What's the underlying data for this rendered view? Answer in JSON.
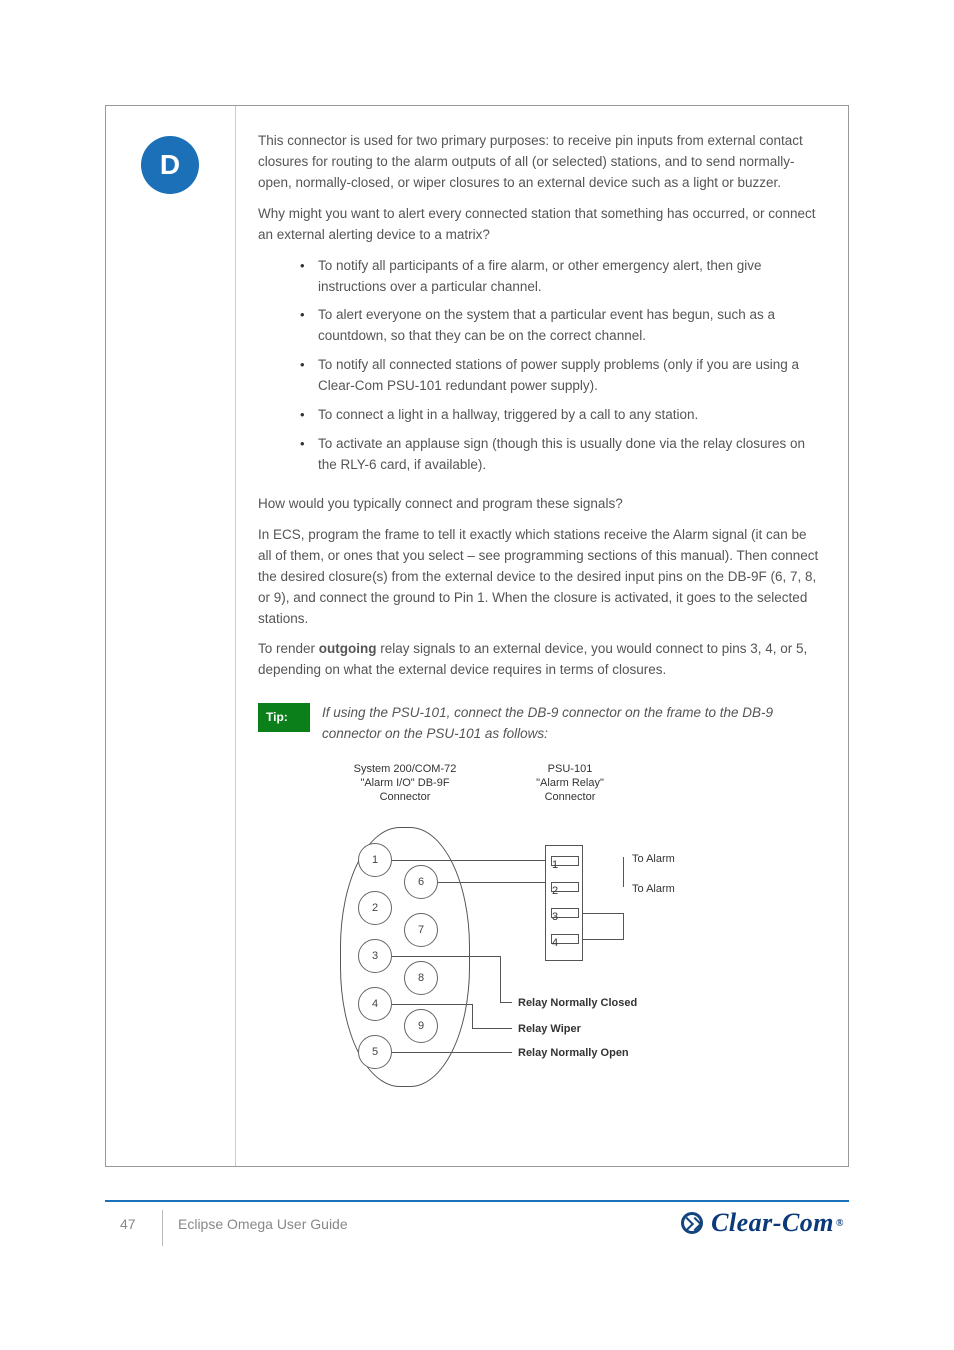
{
  "badge": "D",
  "lead": "This connector is used for two primary purposes: to receive pin inputs from external contact closures for routing to the alarm outputs of all (or selected) stations, and to send normally-open, normally-closed, or wiper closures to an external device such as a light or buzzer.",
  "why_intro": "Why might you want to alert every connected station that something has occurred, or connect an external alerting device to a matrix?",
  "bullets": [
    "To notify all participants of a fire alarm, or other emergency alert, then give instructions over a particular channel.",
    "To alert everyone on the system that a particular event has begun, such as a countdown, so that they can be on the correct channel.",
    "To notify all connected stations of power supply problems (only if you are using a Clear-Com PSU-101 redundant power supply).",
    "To connect a light in a hallway, triggered by a call to any station.",
    "To activate an applause sign (though this is usually done via the relay closures on the RLY-6 card, if available)."
  ],
  "how": "How would you typically connect and program these signals?",
  "how_body": "In ECS, program the frame to tell it exactly which stations receive the Alarm signal (it can be all of them, or ones that you select – see programming sections of this manual). Then connect the desired closure(s) from the external device to the desired input pins on the DB-9F (6, 7, 8, or 9), and connect the ground to Pin 1. When the closure is activated, it goes to the selected stations.",
  "how_body2_a": "To render ",
  "how_body2_b": "outgoing",
  "how_body2_c": " relay signals to an external device, you would connect to pins 3, 4, or 5, depending on what the external device requires in terms of closures.",
  "tip_label": "Tip:",
  "tip_text": "If using the PSU-101, connect the DB-9 connector on the frame to the DB-9 connector on the PSU-101 as follows:",
  "diagram": {
    "left_title": "System 200/COM-72\n\"Alarm I/O\" DB-9F\nConnector",
    "right_title": "PSU-101\n\"Alarm Relay\"\nConnector",
    "pins": [
      "1",
      "6",
      "2",
      "7",
      "3",
      "8",
      "4",
      "9",
      "5"
    ],
    "psu_ports": [
      "1",
      "2",
      "3",
      "4"
    ],
    "to_alarm": "To Alarm",
    "out_nc": "Relay Normally Closed",
    "out_wiper": "Relay Wiper",
    "out_no": "Relay Normally Open"
  },
  "footer": {
    "page": "47",
    "doc": "Eclipse Omega User Guide",
    "brand": "Clear-Com"
  }
}
